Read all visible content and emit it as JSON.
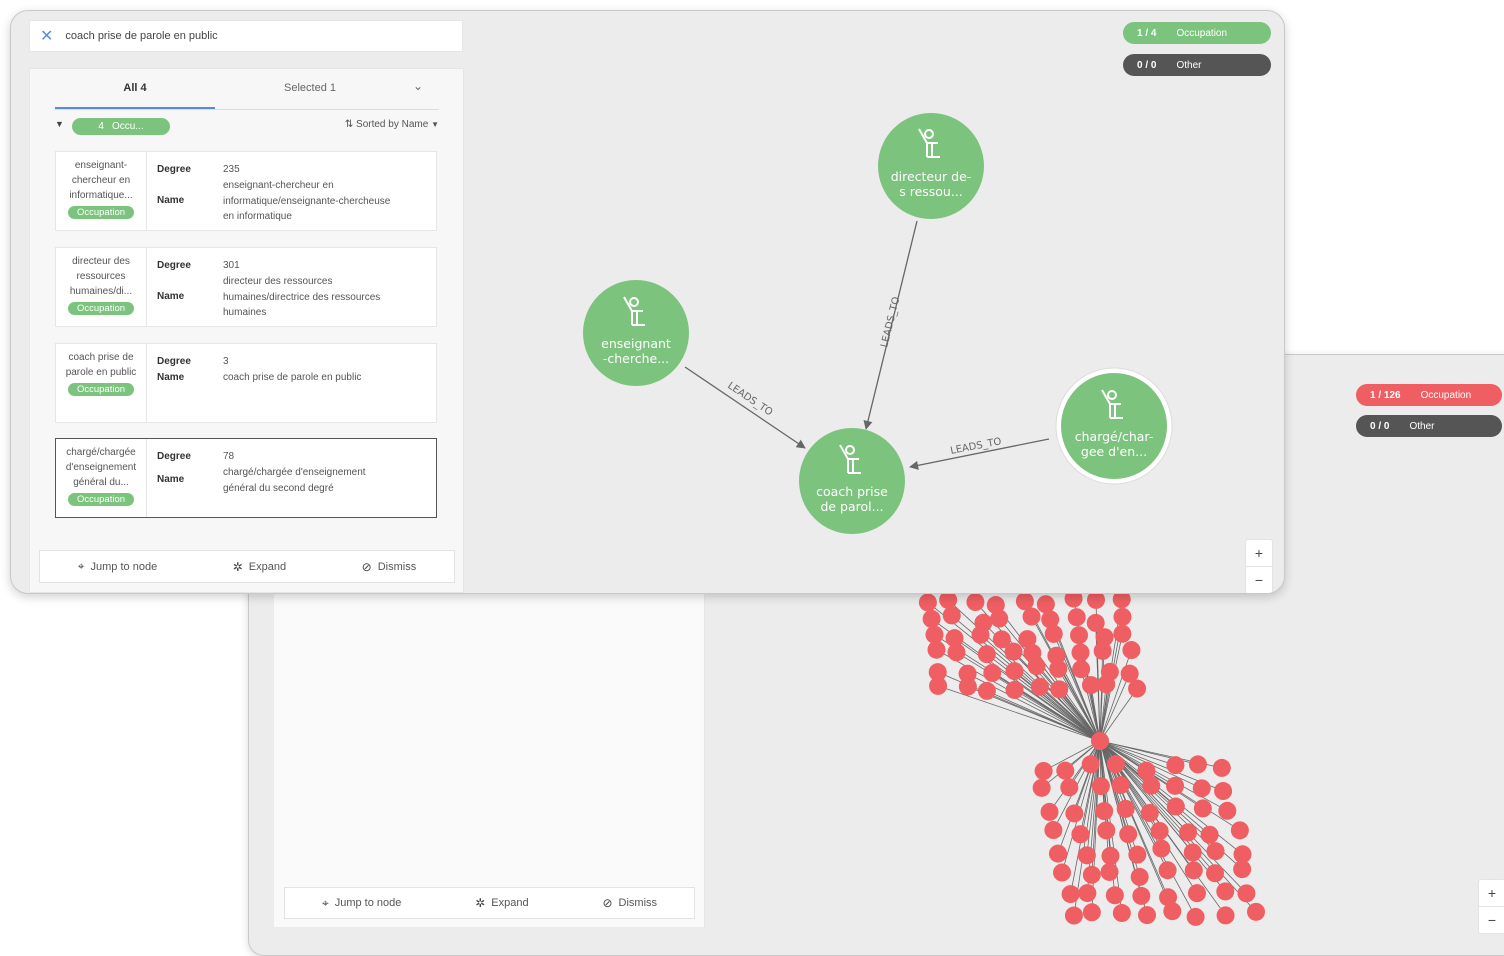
{
  "front": {
    "search": {
      "value": "coach prise de parole en public"
    },
    "tabs": {
      "all": "All 4",
      "selected": "Selected 1"
    },
    "filter": {
      "count": "4",
      "label": "Occu...",
      "sort": "Sorted by Name"
    },
    "cards": [
      {
        "title": "enseignant-chercheur en informatique...",
        "badge": "Occupation",
        "degree_label": "Degree",
        "degree": "235",
        "name_label": "Name",
        "name": "enseignant-chercheur en informatique/enseignante-chercheuse en informatique"
      },
      {
        "title": "directeur des ressources humaines/di...",
        "badge": "Occupation",
        "degree_label": "Degree",
        "degree": "301",
        "name_label": "Name",
        "name": "directeur des ressources humaines/directrice des ressources humaines"
      },
      {
        "title": "coach prise de parole en public",
        "badge": "Occupation",
        "degree_label": "Degree",
        "degree": "3",
        "name_label": "Name",
        "name": "coach prise de parole en public"
      },
      {
        "title": "chargé/chargée d'enseignement général du...",
        "badge": "Occupation",
        "degree_label": "Degree",
        "degree": "78",
        "name_label": "Name",
        "name": "chargé/chargée d'enseignement général du second degré"
      }
    ],
    "actions": {
      "jump": "Jump to node",
      "expand": "Expand",
      "dismiss": "Dismiss"
    },
    "legend": [
      {
        "count": "1 / 4",
        "label": "Occupation",
        "color": "#7cc37e"
      },
      {
        "count": "0 / 0",
        "label": "Other",
        "color": "#555555"
      }
    ],
    "graph": {
      "nodes": [
        {
          "line1": "directeur de-",
          "line2": "s ressou..."
        },
        {
          "line1": "enseignant",
          "line2": "-cherche..."
        },
        {
          "line1": "coach prise",
          "line2": "de parol..."
        },
        {
          "line1": "chargé/char-",
          "line2": "gee d'en..."
        }
      ],
      "edge_label": "LEADS_TO",
      "node_color": "#7cc37e"
    },
    "zoom": {
      "in": "+",
      "out": "−"
    }
  },
  "back": {
    "legend": [
      {
        "count": "1 / 126",
        "label": "Occupation",
        "color": "#ef5e62"
      },
      {
        "count": "0 / 0",
        "label": "Other",
        "color": "#555555"
      }
    ],
    "actions": {
      "jump": "Jump to node",
      "expand": "Expand",
      "dismiss": "Dismiss"
    },
    "node_color": "#ef5e62",
    "zoom": {
      "in": "+",
      "out": "−"
    }
  }
}
